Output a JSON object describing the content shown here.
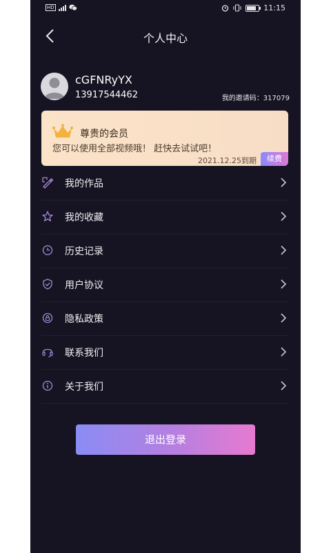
{
  "status_bar": {
    "time": "11:15",
    "network": "HD"
  },
  "header": {
    "title": "个人中心"
  },
  "profile": {
    "username": "cGFNRyYX",
    "phone": "13917544462",
    "invite_code_label": "我的邀请码：317079"
  },
  "vip": {
    "title": "尊贵的会员",
    "description": "您可以使用全部视频哦！ 赶快去试试吧！",
    "expire": "2021.12.25到期",
    "renew_label": "续费"
  },
  "menu": {
    "items": [
      {
        "label": "我的作品",
        "icon": "pencil-ruler-icon"
      },
      {
        "label": "我的收藏",
        "icon": "star-icon"
      },
      {
        "label": "历史记录",
        "icon": "clock-icon"
      },
      {
        "label": "用户协议",
        "icon": "shield-check-icon"
      },
      {
        "label": "隐私政策",
        "icon": "lock-icon"
      },
      {
        "label": "联系我们",
        "icon": "headset-icon"
      },
      {
        "label": "关于我们",
        "icon": "info-icon"
      }
    ]
  },
  "logout": {
    "label": "退出登录"
  },
  "colors": {
    "background": "#161422",
    "accent_purple": "#a78bdb",
    "vip_gold": "#f2b33d",
    "logout_gradient_start": "#8a8cf4",
    "logout_gradient_end": "#e77ad0"
  }
}
